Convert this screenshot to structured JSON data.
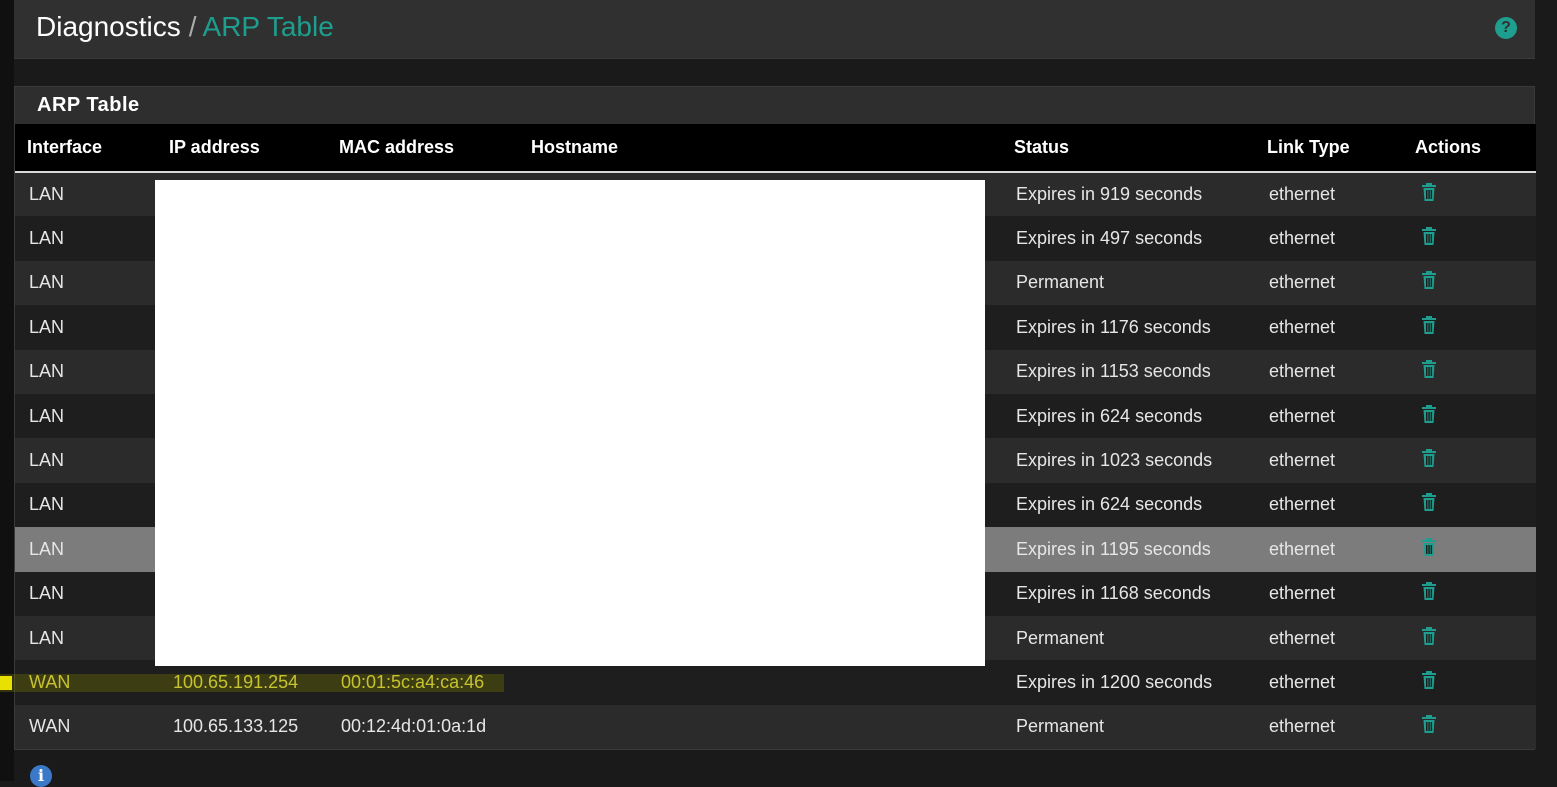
{
  "breadcrumb": {
    "root": "Diagnostics",
    "separator": "/",
    "current": "ARP Table"
  },
  "help_icon": "question-circle-icon",
  "panel": {
    "title": "ARP Table"
  },
  "table": {
    "headers": {
      "interface": "Interface",
      "ip": "IP address",
      "mac": "MAC address",
      "hostname": "Hostname",
      "status": "Status",
      "link_type": "Link Type",
      "actions": "Actions"
    },
    "rows": [
      {
        "interface": "LAN",
        "ip": "",
        "mac": "",
        "hostname": "",
        "status": "Expires in 919 seconds",
        "link_type": "ethernet"
      },
      {
        "interface": "LAN",
        "ip": "",
        "mac": "",
        "hostname": "",
        "status": "Expires in 497 seconds",
        "link_type": "ethernet"
      },
      {
        "interface": "LAN",
        "ip": "",
        "mac": "",
        "hostname": "",
        "status": "Permanent",
        "link_type": "ethernet"
      },
      {
        "interface": "LAN",
        "ip": "",
        "mac": "",
        "hostname": "",
        "status": "Expires in 1176 seconds",
        "link_type": "ethernet"
      },
      {
        "interface": "LAN",
        "ip": "",
        "mac": "",
        "hostname": "",
        "status": "Expires in 1153 seconds",
        "link_type": "ethernet"
      },
      {
        "interface": "LAN",
        "ip": "",
        "mac": "",
        "hostname": "",
        "status": "Expires in 624 seconds",
        "link_type": "ethernet"
      },
      {
        "interface": "LAN",
        "ip": "",
        "mac": "",
        "hostname": "",
        "status": "Expires in 1023 seconds",
        "link_type": "ethernet"
      },
      {
        "interface": "LAN",
        "ip": "",
        "mac": "",
        "hostname": "",
        "status": "Expires in 624 seconds",
        "link_type": "ethernet"
      },
      {
        "interface": "LAN",
        "ip": "",
        "mac": "",
        "hostname": "",
        "status": "Expires in 1195 seconds",
        "link_type": "ethernet"
      },
      {
        "interface": "LAN",
        "ip": "",
        "mac": "",
        "hostname": "",
        "status": "Expires in 1168 seconds",
        "link_type": "ethernet"
      },
      {
        "interface": "LAN",
        "ip": "",
        "mac": "",
        "hostname": "",
        "status": "Permanent",
        "link_type": "ethernet"
      },
      {
        "interface": "WAN",
        "ip": "100.65.191.254",
        "mac": "00:01:5c:a4:ca:46",
        "hostname": "",
        "status": "Expires in 1200 seconds",
        "link_type": "ethernet"
      },
      {
        "interface": "WAN",
        "ip": "100.65.133.125",
        "mac": "00:12:4d:01:0a:1d",
        "hostname": "",
        "status": "Permanent",
        "link_type": "ethernet"
      }
    ],
    "action_icon": "trash-icon"
  },
  "info_icon": "info-circle-icon",
  "colors": {
    "accent": "#1e9e8e",
    "highlight_text": "#f0ea4a",
    "hover_row": "#7c7c7c"
  }
}
